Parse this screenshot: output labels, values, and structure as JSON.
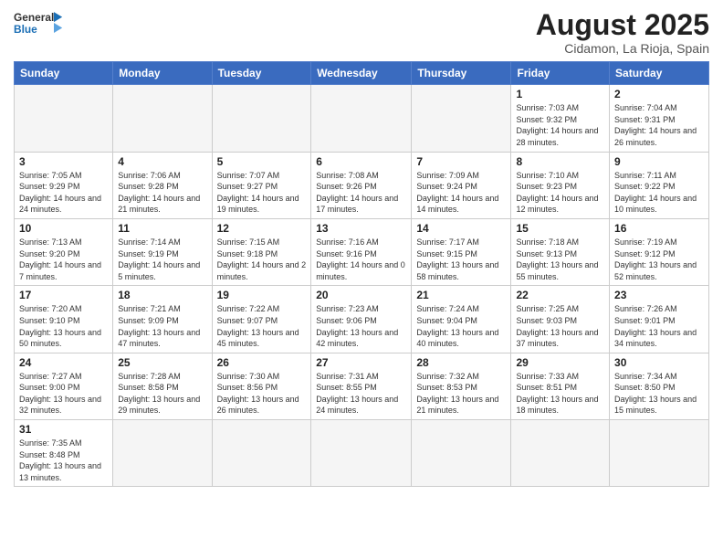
{
  "header": {
    "logo_general": "General",
    "logo_blue": "Blue",
    "month_year": "August 2025",
    "location": "Cidamon, La Rioja, Spain"
  },
  "weekdays": [
    "Sunday",
    "Monday",
    "Tuesday",
    "Wednesday",
    "Thursday",
    "Friday",
    "Saturday"
  ],
  "weeks": [
    [
      {
        "day": "",
        "info": ""
      },
      {
        "day": "",
        "info": ""
      },
      {
        "day": "",
        "info": ""
      },
      {
        "day": "",
        "info": ""
      },
      {
        "day": "",
        "info": ""
      },
      {
        "day": "1",
        "info": "Sunrise: 7:03 AM\nSunset: 9:32 PM\nDaylight: 14 hours and 28 minutes."
      },
      {
        "day": "2",
        "info": "Sunrise: 7:04 AM\nSunset: 9:31 PM\nDaylight: 14 hours and 26 minutes."
      }
    ],
    [
      {
        "day": "3",
        "info": "Sunrise: 7:05 AM\nSunset: 9:29 PM\nDaylight: 14 hours and 24 minutes."
      },
      {
        "day": "4",
        "info": "Sunrise: 7:06 AM\nSunset: 9:28 PM\nDaylight: 14 hours and 21 minutes."
      },
      {
        "day": "5",
        "info": "Sunrise: 7:07 AM\nSunset: 9:27 PM\nDaylight: 14 hours and 19 minutes."
      },
      {
        "day": "6",
        "info": "Sunrise: 7:08 AM\nSunset: 9:26 PM\nDaylight: 14 hours and 17 minutes."
      },
      {
        "day": "7",
        "info": "Sunrise: 7:09 AM\nSunset: 9:24 PM\nDaylight: 14 hours and 14 minutes."
      },
      {
        "day": "8",
        "info": "Sunrise: 7:10 AM\nSunset: 9:23 PM\nDaylight: 14 hours and 12 minutes."
      },
      {
        "day": "9",
        "info": "Sunrise: 7:11 AM\nSunset: 9:22 PM\nDaylight: 14 hours and 10 minutes."
      }
    ],
    [
      {
        "day": "10",
        "info": "Sunrise: 7:13 AM\nSunset: 9:20 PM\nDaylight: 14 hours and 7 minutes."
      },
      {
        "day": "11",
        "info": "Sunrise: 7:14 AM\nSunset: 9:19 PM\nDaylight: 14 hours and 5 minutes."
      },
      {
        "day": "12",
        "info": "Sunrise: 7:15 AM\nSunset: 9:18 PM\nDaylight: 14 hours and 2 minutes."
      },
      {
        "day": "13",
        "info": "Sunrise: 7:16 AM\nSunset: 9:16 PM\nDaylight: 14 hours and 0 minutes."
      },
      {
        "day": "14",
        "info": "Sunrise: 7:17 AM\nSunset: 9:15 PM\nDaylight: 13 hours and 58 minutes."
      },
      {
        "day": "15",
        "info": "Sunrise: 7:18 AM\nSunset: 9:13 PM\nDaylight: 13 hours and 55 minutes."
      },
      {
        "day": "16",
        "info": "Sunrise: 7:19 AM\nSunset: 9:12 PM\nDaylight: 13 hours and 52 minutes."
      }
    ],
    [
      {
        "day": "17",
        "info": "Sunrise: 7:20 AM\nSunset: 9:10 PM\nDaylight: 13 hours and 50 minutes."
      },
      {
        "day": "18",
        "info": "Sunrise: 7:21 AM\nSunset: 9:09 PM\nDaylight: 13 hours and 47 minutes."
      },
      {
        "day": "19",
        "info": "Sunrise: 7:22 AM\nSunset: 9:07 PM\nDaylight: 13 hours and 45 minutes."
      },
      {
        "day": "20",
        "info": "Sunrise: 7:23 AM\nSunset: 9:06 PM\nDaylight: 13 hours and 42 minutes."
      },
      {
        "day": "21",
        "info": "Sunrise: 7:24 AM\nSunset: 9:04 PM\nDaylight: 13 hours and 40 minutes."
      },
      {
        "day": "22",
        "info": "Sunrise: 7:25 AM\nSunset: 9:03 PM\nDaylight: 13 hours and 37 minutes."
      },
      {
        "day": "23",
        "info": "Sunrise: 7:26 AM\nSunset: 9:01 PM\nDaylight: 13 hours and 34 minutes."
      }
    ],
    [
      {
        "day": "24",
        "info": "Sunrise: 7:27 AM\nSunset: 9:00 PM\nDaylight: 13 hours and 32 minutes."
      },
      {
        "day": "25",
        "info": "Sunrise: 7:28 AM\nSunset: 8:58 PM\nDaylight: 13 hours and 29 minutes."
      },
      {
        "day": "26",
        "info": "Sunrise: 7:30 AM\nSunset: 8:56 PM\nDaylight: 13 hours and 26 minutes."
      },
      {
        "day": "27",
        "info": "Sunrise: 7:31 AM\nSunset: 8:55 PM\nDaylight: 13 hours and 24 minutes."
      },
      {
        "day": "28",
        "info": "Sunrise: 7:32 AM\nSunset: 8:53 PM\nDaylight: 13 hours and 21 minutes."
      },
      {
        "day": "29",
        "info": "Sunrise: 7:33 AM\nSunset: 8:51 PM\nDaylight: 13 hours and 18 minutes."
      },
      {
        "day": "30",
        "info": "Sunrise: 7:34 AM\nSunset: 8:50 PM\nDaylight: 13 hours and 15 minutes."
      }
    ],
    [
      {
        "day": "31",
        "info": "Sunrise: 7:35 AM\nSunset: 8:48 PM\nDaylight: 13 hours and 13 minutes."
      },
      {
        "day": "",
        "info": ""
      },
      {
        "day": "",
        "info": ""
      },
      {
        "day": "",
        "info": ""
      },
      {
        "day": "",
        "info": ""
      },
      {
        "day": "",
        "info": ""
      },
      {
        "day": "",
        "info": ""
      }
    ]
  ]
}
